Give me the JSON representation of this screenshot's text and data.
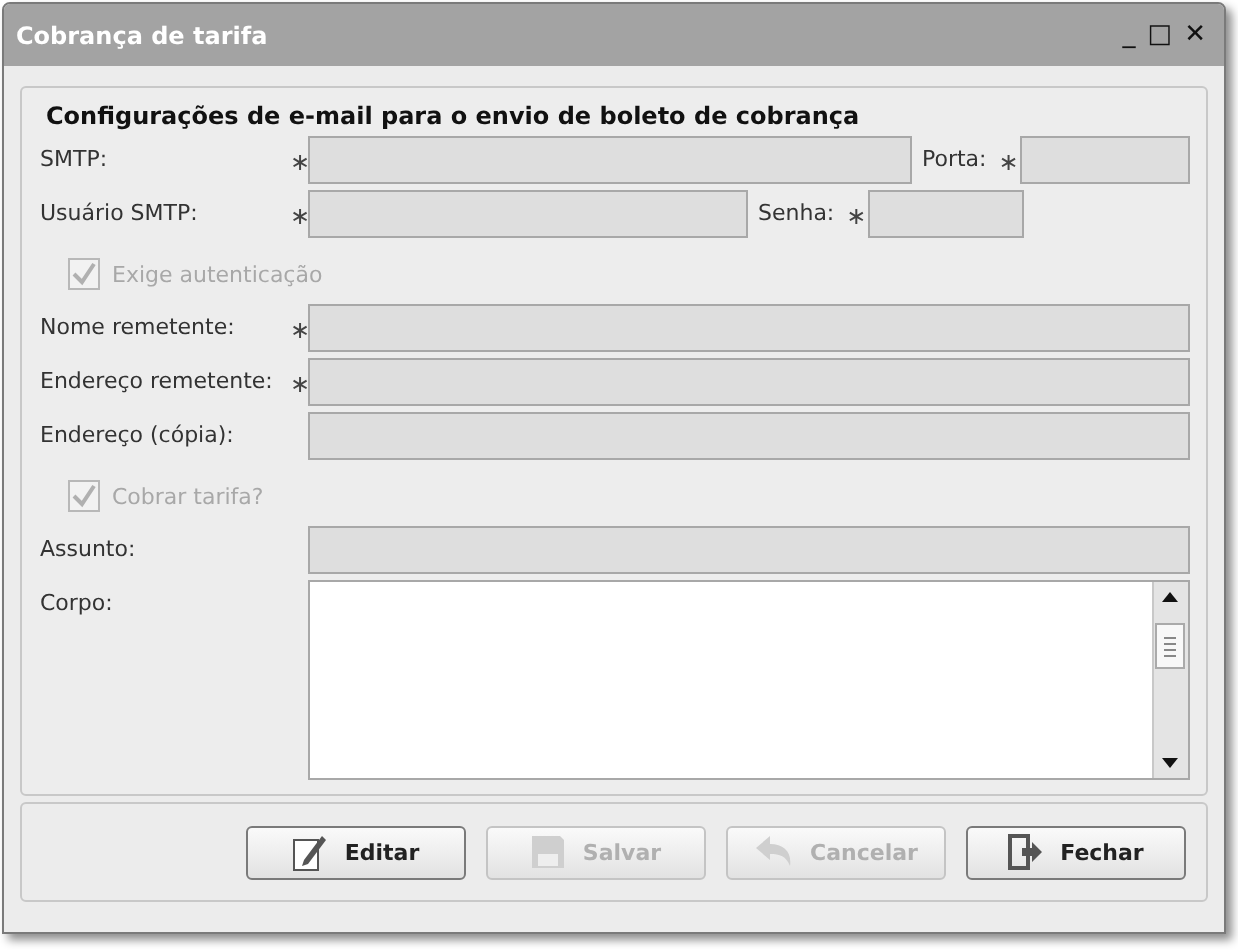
{
  "window": {
    "title": "Cobrança de tarifa",
    "controls": [
      "_",
      "□",
      "✕"
    ]
  },
  "section_title": "Configurações de e-mail para o envio de boleto de cobrança",
  "rows": [
    {
      "kind": "pair",
      "fields": [
        {
          "label": "SMTP:",
          "required_mark": "∗",
          "disabled": true
        },
        {
          "label": "Porta:",
          "required_mark": "∗",
          "disabled": true
        }
      ]
    },
    {
      "kind": "pair",
      "fields": [
        {
          "label": "Usuário SMTP:",
          "required_mark": "∗",
          "disabled": true
        },
        {
          "label": "Senha:",
          "required_mark": "∗",
          "disabled": true
        }
      ]
    },
    {
      "kind": "checkbox",
      "label": "Exige autenticação",
      "checked": true,
      "disabled": true
    },
    {
      "kind": "field",
      "label": "Nome remetente:",
      "required_mark": "∗",
      "disabled": true
    },
    {
      "kind": "field",
      "label": "Endereço remetente:",
      "required_mark": "∗",
      "disabled": true
    },
    {
      "kind": "field",
      "label": "Endereço (cópia):",
      "disabled": true
    },
    {
      "kind": "checkbox",
      "label": "Cobrar tarifa?",
      "checked": true,
      "disabled": true
    },
    {
      "kind": "field",
      "label": "Assunto:",
      "disabled": true
    },
    {
      "kind": "textarea",
      "label": "Corpo:",
      "disabled": false
    }
  ],
  "buttons": [
    {
      "label": "Editar",
      "kind": "edit",
      "disabled": false
    },
    {
      "label": "Salvar",
      "kind": "save",
      "disabled": true
    },
    {
      "label": "Cancelar",
      "kind": "undo",
      "disabled": true
    },
    {
      "label": "Fechar",
      "kind": "exit",
      "disabled": false
    }
  ]
}
